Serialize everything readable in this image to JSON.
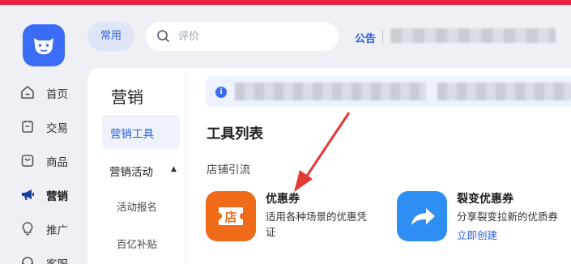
{
  "colors": {
    "top_bar": "#e8213f",
    "accent": "#2b5fd9",
    "logo": "#3b6cf6",
    "coupon_icon": "#ef6a19",
    "share_icon": "#2f8ef3",
    "annotation_arrow": "#e53935"
  },
  "logo": {
    "icon": "cow-head-icon"
  },
  "nav": {
    "items": [
      {
        "label": "首页",
        "icon": "home-icon"
      },
      {
        "label": "交易",
        "icon": "clipboard-icon"
      },
      {
        "label": "商品",
        "icon": "bag-icon"
      },
      {
        "label": "营销",
        "icon": "megaphone-icon",
        "active": true
      },
      {
        "label": "推广",
        "icon": "bulb-icon"
      },
      {
        "label": "客服",
        "icon": "headset-icon"
      }
    ]
  },
  "header": {
    "common_chip": "常用",
    "search": {
      "placeholder": "评价",
      "value": ""
    },
    "notice_label": "公告"
  },
  "submenu": {
    "title": "营销",
    "selected": "营销工具",
    "group": "营销活动",
    "items": [
      "活动报名",
      "百亿补贴"
    ]
  },
  "main": {
    "title": "工具列表",
    "section": "店铺引流",
    "tools": [
      {
        "name": "优惠券",
        "desc": "适用各种场景的优惠凭证",
        "icon_text": "店",
        "icon": "coupon-store-icon"
      },
      {
        "name": "裂变优惠券",
        "desc": "分享裂变拉新的优质券",
        "link": "立即创建",
        "icon": "share-arrow-icon"
      }
    ]
  }
}
